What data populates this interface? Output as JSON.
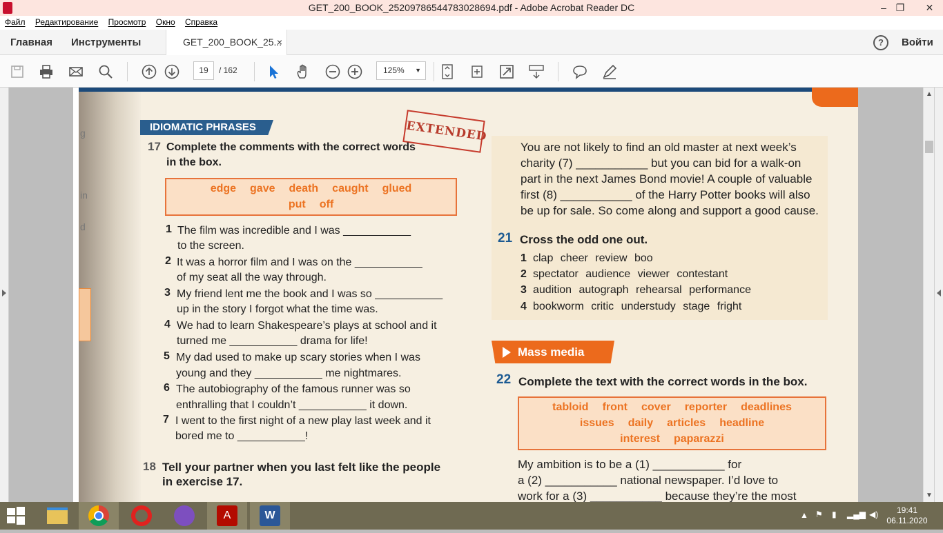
{
  "window": {
    "title": "GET_200_BOOK_2520978654478302869​4.pdf - Adobe Acrobat Reader DC",
    "min": "–",
    "max": "❐",
    "close": "✕"
  },
  "menu": [
    "Файл",
    "Редактирование",
    "Просмотр",
    "Окно",
    "Справка"
  ],
  "tabs": {
    "home": "Главная",
    "tools": "Инструменты",
    "doc": "GET_200_BOOK_25...",
    "close": "×",
    "login": "Войти",
    "help": "?"
  },
  "toolbar": {
    "page_current": "19",
    "page_total": "/ 162",
    "zoom": "125%"
  },
  "page": {
    "left_hints": [
      "g",
      "in",
      "d"
    ],
    "header": "IDIOMATIC PHRASES",
    "stamp": "EXTENDED",
    "ex17": {
      "num": "17",
      "title_line1": "Complete the comments with the correct words",
      "title_line2": "in the box.",
      "words_row1": [
        "edge",
        "gave",
        "death",
        "caught",
        "glued"
      ],
      "words_row2": [
        "put",
        "off"
      ],
      "items": [
        {
          "n": "1",
          "l1": "The film was incredible and I was ___________",
          "l2": "to the screen."
        },
        {
          "n": "2",
          "l1": "It was a horror film and I was on the ___________",
          "l2": "of my seat all the way through."
        },
        {
          "n": "3",
          "l1": "My friend lent me the book and I was so ___________",
          "l2": "up in the story I forgot what the time was."
        },
        {
          "n": "4",
          "l1": "We had to learn Shakespeare’s plays at school and it",
          "l2": "turned me ___________ drama for life!"
        },
        {
          "n": "5",
          "l1": "My dad used to make up scary stories when I was",
          "l2": "young and they ___________ me nightmares."
        },
        {
          "n": "6",
          "l1": "The autobiography of the famous runner was so",
          "l2": "enthralling that I couldn’t ___________ it down."
        },
        {
          "n": "7",
          "l1": "I went to the first night of a new play last week and it",
          "l2": "bored me to ___________!"
        }
      ]
    },
    "ex18": {
      "num": "18",
      "title_line1": "Tell your partner when you last felt like the people",
      "title_line2": "in exercise 17."
    },
    "right_text": [
      "You are not likely to find an old master at next week’s",
      "charity (7) ___________ but you can bid for a walk-on",
      "part in the next James Bond movie! A couple of valuable",
      "first (8) ___________ of the Harry Potter books will also",
      "be up for sale. So come along and support a good cause."
    ],
    "ex21": {
      "num": "21",
      "title": "Cross the odd one out.",
      "items": [
        {
          "n": "1",
          "t": "clap cheer review boo"
        },
        {
          "n": "2",
          "t": "spectator audience viewer contestant"
        },
        {
          "n": "3",
          "t": "audition autograph rehearsal performance"
        },
        {
          "n": "4",
          "t": "bookworm critic understudy stage fright"
        }
      ]
    },
    "section": "Mass media",
    "ex22": {
      "num": "22",
      "title": "Complete the text with the correct words in the box.",
      "words_row1": [
        "tabloid",
        "front",
        "cover",
        "reporter",
        "deadlines"
      ],
      "words_row2": [
        "issues",
        "daily",
        "articles",
        "headline"
      ],
      "words_row3": [
        "interest",
        "paparazzi"
      ],
      "text": [
        "My ambition is to be a (1) ___________ for",
        "a (2) ___________ national newspaper. I’d love to",
        "work for a (3) ___________ because they’re the most"
      ]
    }
  },
  "taskbar": {
    "time": "19:41",
    "date": "06.11.2020"
  }
}
